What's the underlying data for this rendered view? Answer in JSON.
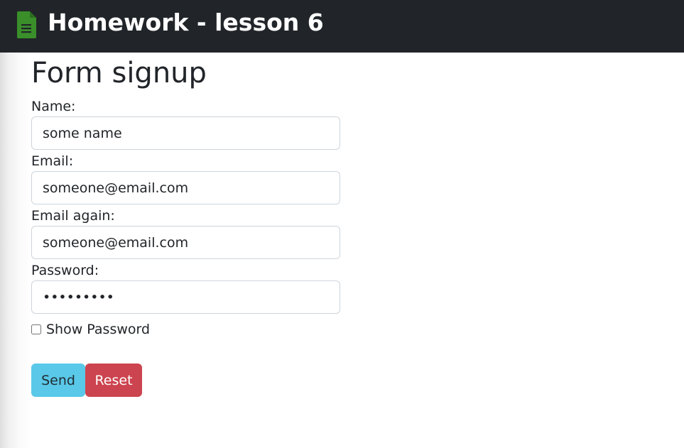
{
  "navbar": {
    "title": "Homework - lesson 6",
    "icon": "document-icon",
    "icon_color": "#3a8f2a",
    "background": "#212529"
  },
  "form": {
    "title": "Form signup",
    "fields": {
      "name": {
        "label": "Name:",
        "value": "some name"
      },
      "email": {
        "label": "Email:",
        "value": "someone@email.com"
      },
      "email_again": {
        "label": "Email again:",
        "value": "someone@email.com"
      },
      "password": {
        "label": "Password:",
        "value": "•••••••••"
      }
    },
    "show_password": {
      "label": "Show Password",
      "checked": false
    },
    "buttons": {
      "send": {
        "label": "Send",
        "color": "#5ac8e8"
      },
      "reset": {
        "label": "Reset",
        "color": "#cc444f"
      }
    }
  }
}
